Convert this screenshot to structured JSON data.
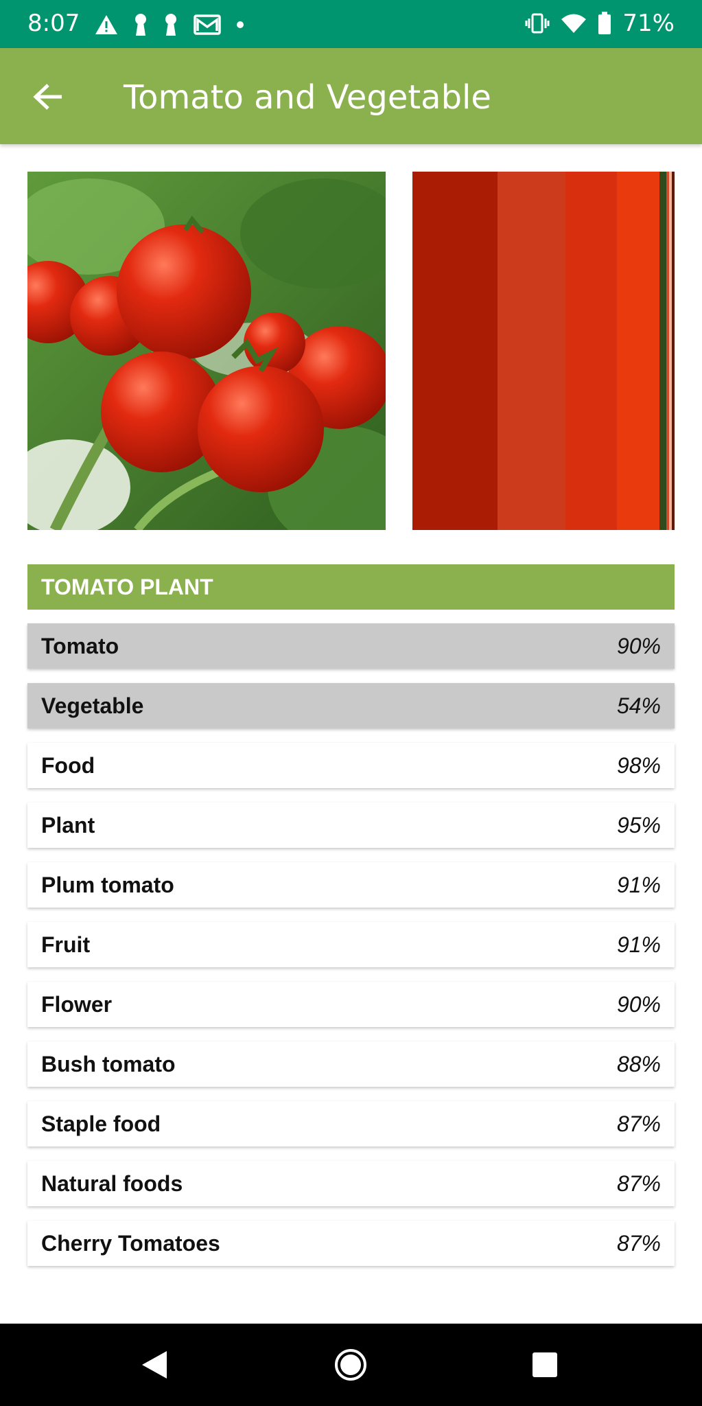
{
  "status_bar": {
    "time": "8:07",
    "battery": "71%",
    "left_icons": [
      "warning-icon",
      "keyhole-icon",
      "keyhole-icon",
      "gmail-icon",
      "dot-icon"
    ],
    "right_icons": [
      "vibrate-icon",
      "wifi-icon",
      "battery-icon"
    ]
  },
  "app_bar": {
    "title": "Tomato and Vegetable",
    "back_icon": "arrow-back-icon",
    "color": "#8bb14e"
  },
  "palette": {
    "colors": [
      "#aa1c04",
      "#cc3b1c",
      "#d8300f",
      "#e83a0c",
      "#2f4a1c",
      "#d24a2a",
      "#f4b59a",
      "#5b1a0c"
    ],
    "proportions": [
      32.5,
      26,
      19.5,
      16.3,
      2.6,
      1,
      1.1,
      1
    ]
  },
  "section": {
    "header": "TOMATO PLANT"
  },
  "labels": [
    {
      "name": "Tomato",
      "score": "90%"
    },
    {
      "name": "Vegetable",
      "score": "54%"
    },
    {
      "name": "Food",
      "score": "98%"
    },
    {
      "name": "Plant",
      "score": "95%"
    },
    {
      "name": "Plum tomato",
      "score": "91%"
    },
    {
      "name": "Fruit",
      "score": "91%"
    },
    {
      "name": "Flower",
      "score": "90%"
    },
    {
      "name": "Bush tomato",
      "score": "88%"
    },
    {
      "name": "Staple food",
      "score": "87%"
    },
    {
      "name": "Natural foods",
      "score": "87%"
    },
    {
      "name": "Cherry Tomatoes",
      "score": "87%"
    }
  ],
  "nav_bar": {
    "icons": [
      "back-triangle-icon",
      "home-circle-icon",
      "recents-square-icon"
    ]
  }
}
